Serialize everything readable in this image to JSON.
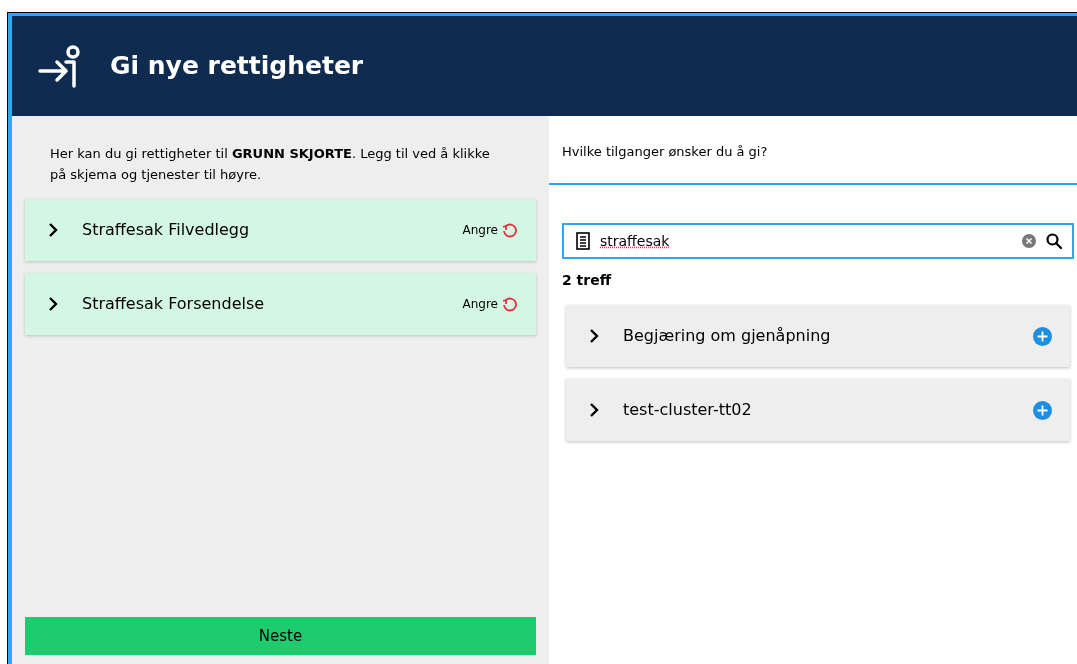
{
  "header": {
    "title": "Gi nye rettigheter"
  },
  "left": {
    "intro": "Her kan du gi rettigheter til **GRUNN SKJORTE**. Legg til ved å klikke på skjema og tjenester til høyre.",
    "selected": [
      {
        "label": "Straffesak Filvedlegg",
        "undo_label": "Angre"
      },
      {
        "label": "Straffesak Forsendelse",
        "undo_label": "Angre"
      }
    ],
    "next_button": "Neste"
  },
  "right": {
    "question": "Hvilke tilganger ønsker du å gi?",
    "search": {
      "value": "straffesak"
    },
    "result_count": "2 treff",
    "results": [
      {
        "label": "Begjæring om gjenåpning"
      },
      {
        "label": "test-cluster-tt02"
      }
    ]
  }
}
